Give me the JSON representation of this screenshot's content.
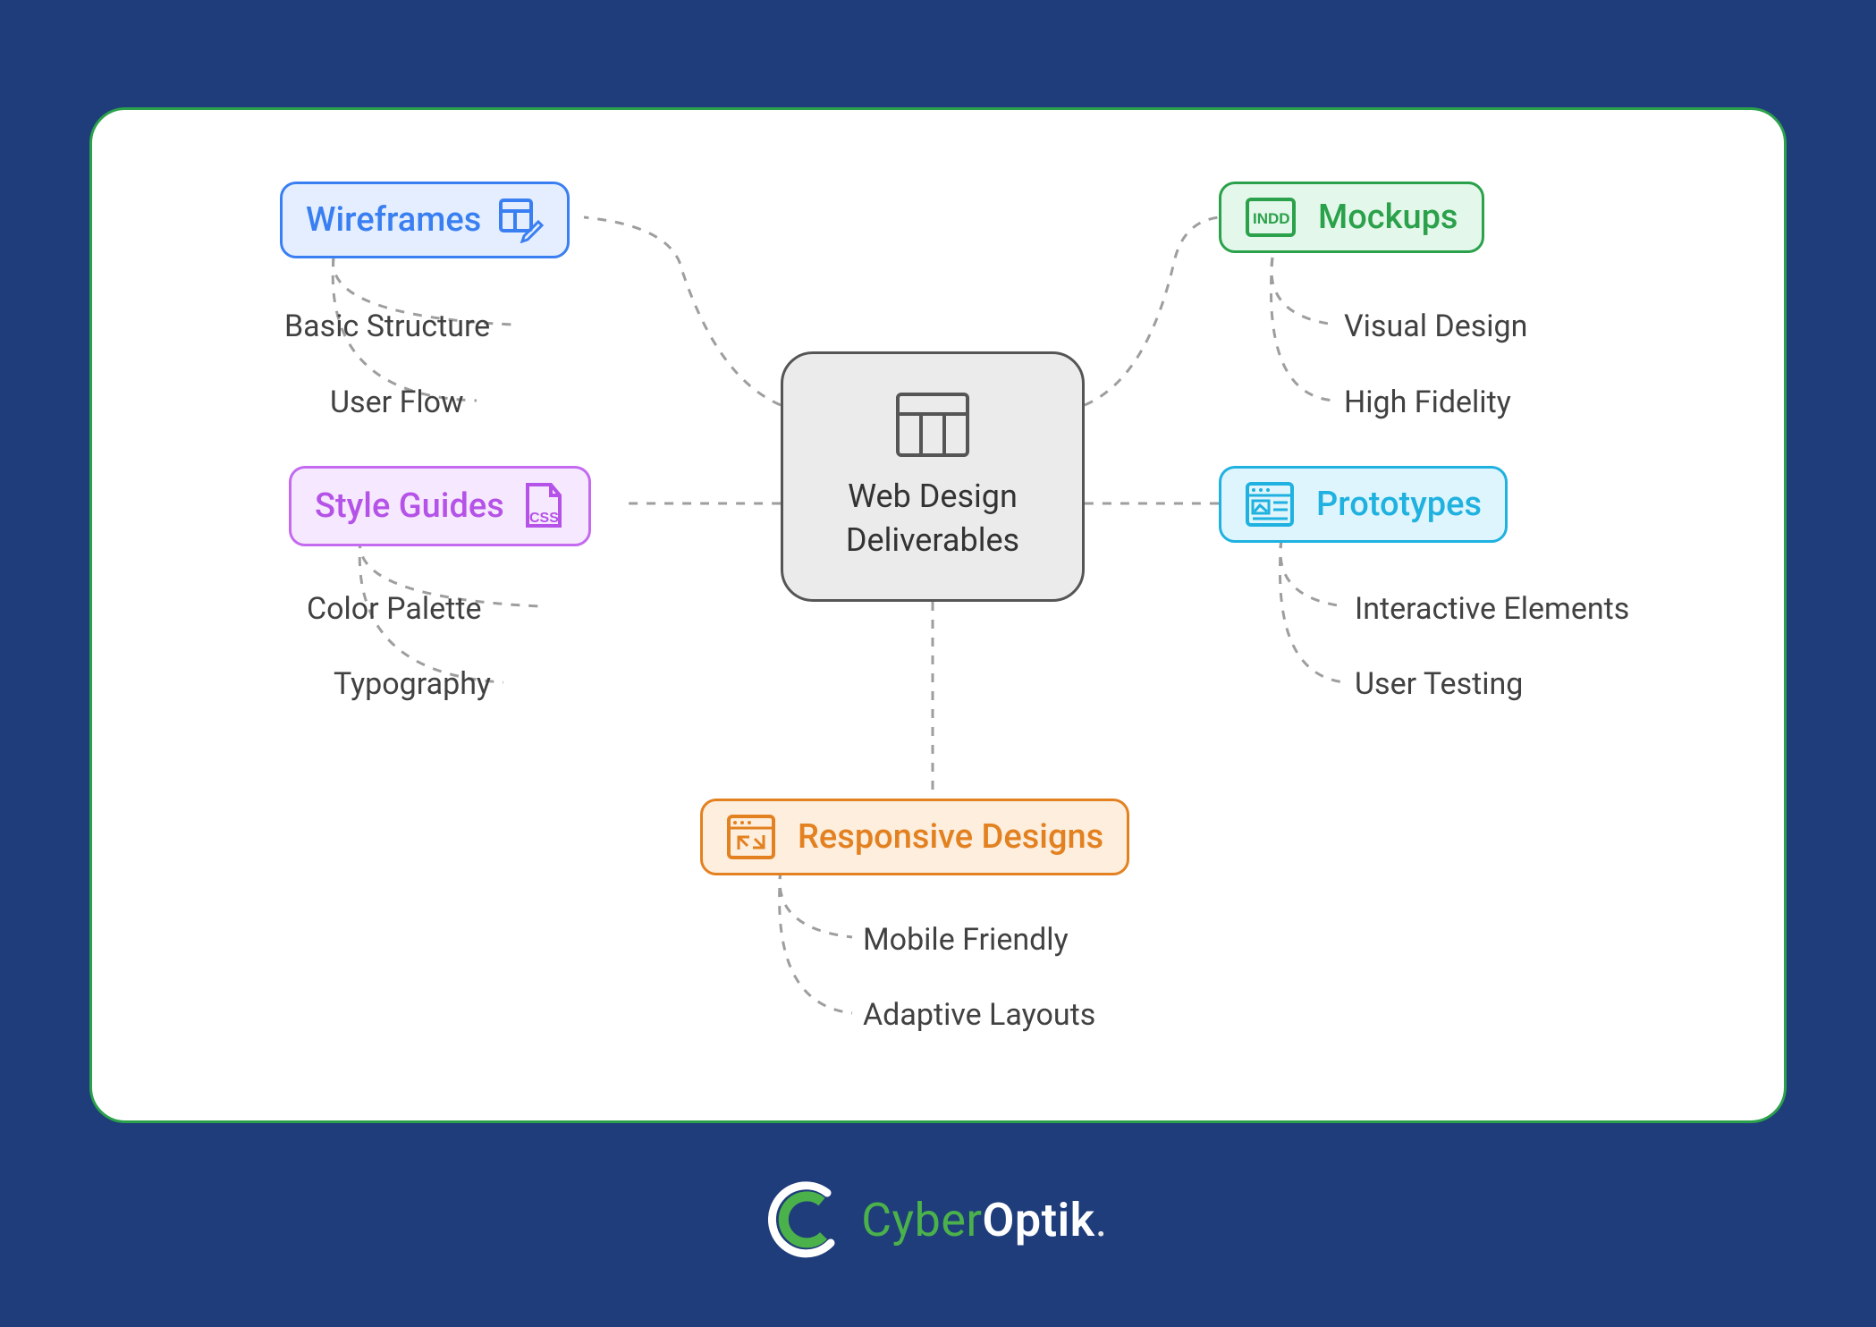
{
  "center": {
    "title_line1": "Web Design",
    "title_line2": "Deliverables"
  },
  "branches": {
    "wireframes": {
      "label": "Wireframes",
      "subs": [
        "Basic Structure",
        "User Flow"
      ],
      "color": "#3a7ff2",
      "bg": "#e4eeff",
      "border": "#3a7ff2"
    },
    "styleguides": {
      "label": "Style Guides",
      "subs": [
        "Color Palette",
        "Typography"
      ],
      "color": "#b552e8",
      "bg": "#f6e9ff",
      "border": "#c36af0"
    },
    "mockups": {
      "label": "Mockups",
      "subs": [
        "Visual Design",
        "High Fidelity"
      ],
      "color": "#2aa14a",
      "bg": "#e3f7ea",
      "border": "#2aa14a"
    },
    "prototypes": {
      "label": "Prototypes",
      "subs": [
        "Interactive Elements",
        "User Testing"
      ],
      "color": "#1fb1df",
      "bg": "#def5fd",
      "border": "#1fb1df"
    },
    "responsive": {
      "label": "Responsive Designs",
      "subs": [
        "Mobile Friendly",
        "Adaptive Layouts"
      ],
      "color": "#e38121",
      "bg": "#fdeedd",
      "border": "#e38121"
    }
  },
  "brand": {
    "name_html_parts": [
      "Cyber",
      "Optik",
      "."
    ]
  }
}
